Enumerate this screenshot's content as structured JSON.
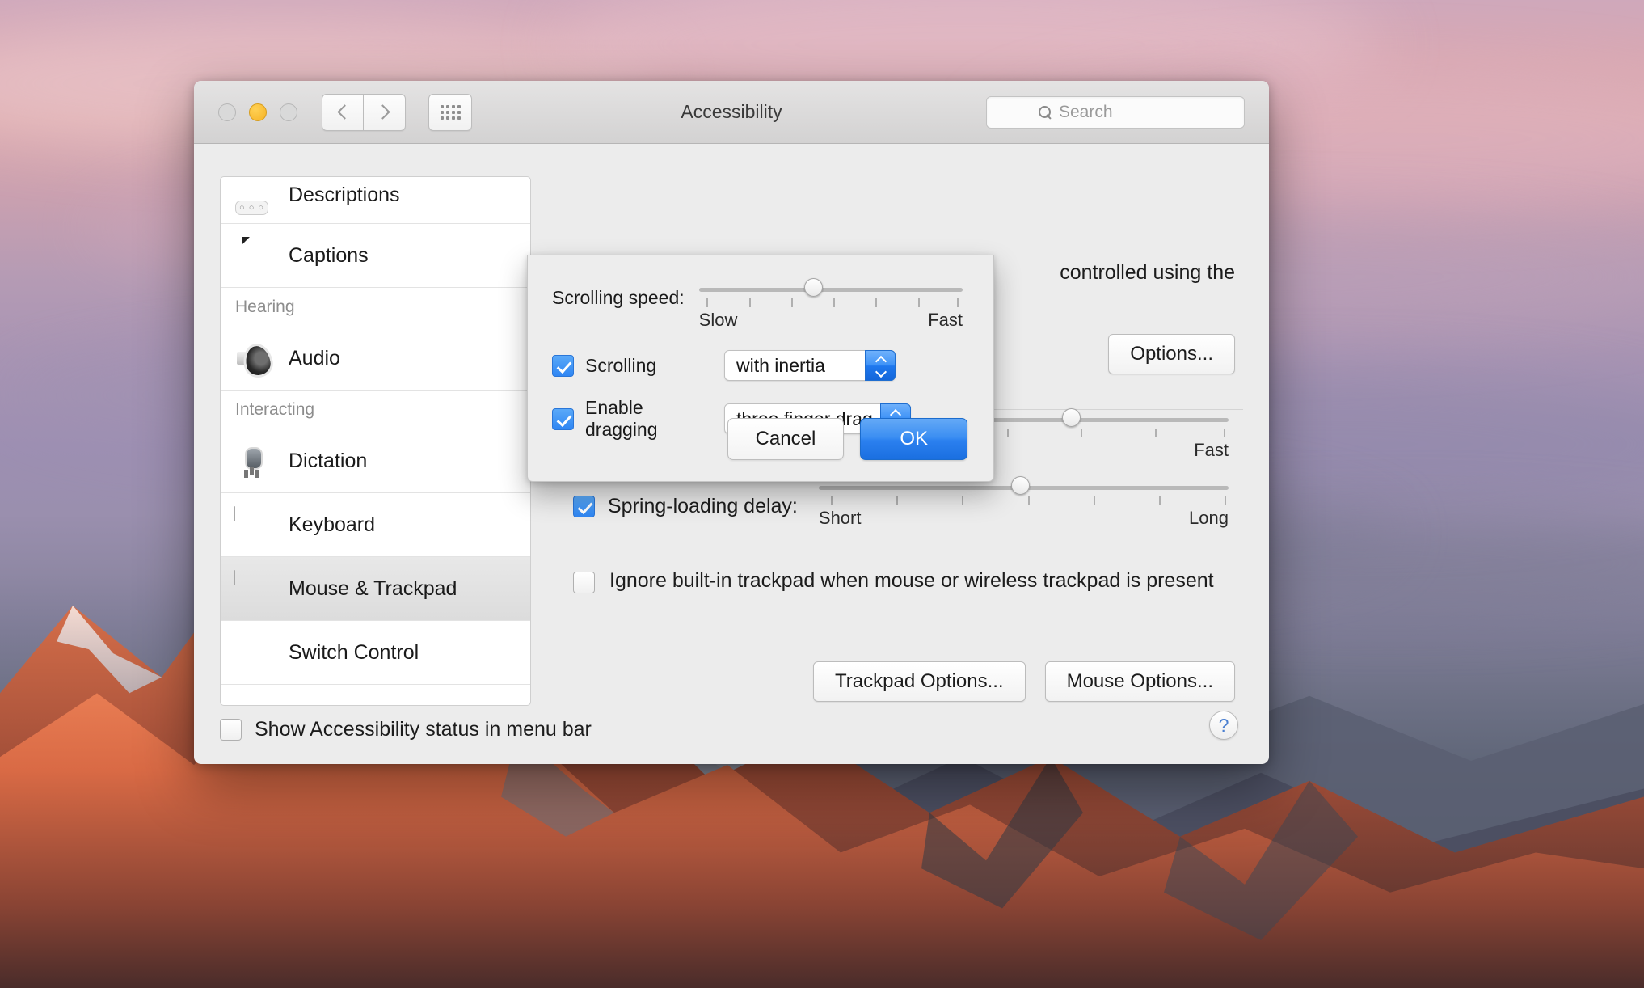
{
  "window": {
    "title": "Accessibility",
    "traffic_lights": [
      "close",
      "minimize",
      "maximize"
    ],
    "nav_back": "back",
    "nav_forward": "forward",
    "show_all": "show-all-grid"
  },
  "search": {
    "placeholder": "Search",
    "value": ""
  },
  "sidebar": {
    "items": [
      {
        "label": "Descriptions",
        "icon": "descriptions-icon",
        "type": "item",
        "selected": false
      },
      {
        "label": "Captions",
        "icon": "captions-icon",
        "type": "item",
        "selected": false
      },
      {
        "label": "Hearing",
        "icon": "",
        "type": "group"
      },
      {
        "label": "Audio",
        "icon": "audio-icon",
        "type": "item",
        "selected": false
      },
      {
        "label": "Interacting",
        "icon": "",
        "type": "group"
      },
      {
        "label": "Dictation",
        "icon": "dictation-icon",
        "type": "item",
        "selected": false
      },
      {
        "label": "Keyboard",
        "icon": "keyboard-icon",
        "type": "item",
        "selected": false
      },
      {
        "label": "Mouse & Trackpad",
        "icon": "mouse-icon",
        "type": "item",
        "selected": true
      },
      {
        "label": "Switch Control",
        "icon": "switch-control-icon",
        "type": "item",
        "selected": false
      }
    ]
  },
  "content": {
    "intro_text": "controlled using the",
    "options_button": "Options...",
    "double_click_end_label": "Fast",
    "spring_loading_label": "Spring-loading delay:",
    "spring_loading_checked": true,
    "spring_short": "Short",
    "spring_long": "Long",
    "ignore_trackpad_label": "Ignore built-in trackpad when mouse or wireless trackpad is present",
    "ignore_trackpad_checked": false,
    "trackpad_options_button": "Trackpad Options...",
    "mouse_options_button": "Mouse Options..."
  },
  "footer": {
    "status_checkbox_label": "Show Accessibility status in menu bar",
    "status_checkbox_checked": false,
    "help_label": "?"
  },
  "sheet": {
    "scrolling_speed_label": "Scrolling speed:",
    "scrolling_speed_value": 42,
    "speed_slow_label": "Slow",
    "speed_fast_label": "Fast",
    "scrolling_checkbox_label": "Scrolling",
    "scrolling_checkbox_checked": true,
    "scrolling_menu_value": "with inertia",
    "dragging_checkbox_label": "Enable dragging",
    "dragging_checkbox_checked": true,
    "dragging_menu_value": "three finger drag",
    "cancel_button": "Cancel",
    "ok_button": "OK"
  },
  "colors": {
    "accent_blue": "#2f86f3",
    "default_button_blue": "#3b8ef2",
    "window_gray": "#ececec",
    "sheet_gray": "#ededed"
  }
}
